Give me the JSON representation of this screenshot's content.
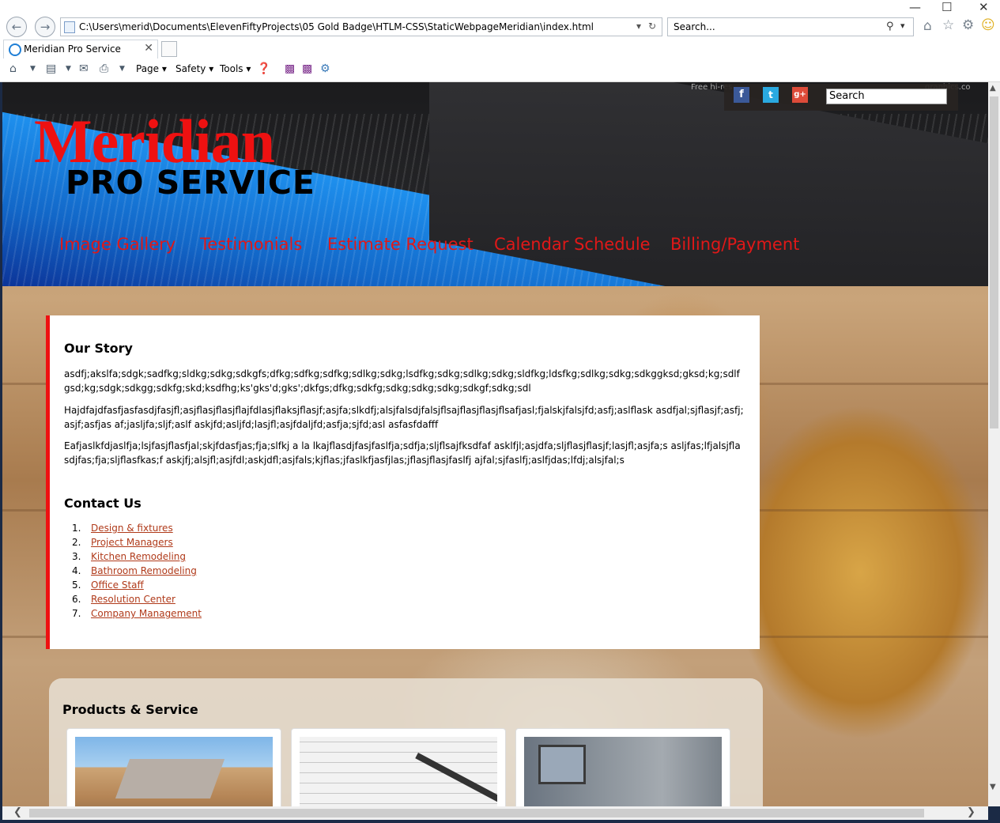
{
  "browser": {
    "address": "C:\\Users\\merid\\Documents\\ElevenFiftyProjects\\05 Gold Badge\\HTLM-CSS\\StaticWebpageMeridian\\index.html",
    "search_placeholder": "Search...",
    "tab_title": "Meridian Pro Service",
    "commands": [
      "Page",
      "Safety",
      "Tools"
    ]
  },
  "header": {
    "title": "Meridian",
    "subtitle": "PRO SERVICE",
    "credit": "Free hi-res",
    "credit_right": "graphics.co",
    "search_placeholder": "Search",
    "nav": [
      "Image Gallery",
      "Testimonials",
      "Estimate Request",
      "Calendar Schedule",
      "Billing/Payment"
    ],
    "social": [
      "facebook",
      "twitter",
      "google-plus"
    ]
  },
  "story": {
    "heading": "Our Story",
    "paragraphs": [
      "asdfj;akslfa;sdgk;sadfkg;sldkg;sdkg;sdkgfs;dfkg;sdfkg;sdfkg;sdlkg;sdkg;lsdfkg;sdkg;sdlkg;sdkg;sldfkg;ldsfkg;sdlkg;sdkg;sdkggksd;gksd;kg;sdlfgsd;kg;sdgk;sdkgg;sdkfg;skd;ksdfhg;ks'gks'd;gks';dkfgs;dfkg;sdkfg;sdkg;sdkg;sdkg;sdkgf;sdkg;sdl",
      "Hajdfajdfasfjasfasdjfasjfl;asjflasjflasjflajfdlasjflaksjflasjf;asjfa;slkdfj;alsjfalsdjfalsjflsajflasjflasjflsafjasl;fjalskjfalsjfd;asfj;aslflask asdfjal;sjflasjf;asfj;asjf;asfjas af;jasljfa;sljf;aslf askjfd;asljfd;lasjfl;asjfdaljfd;asfja;sjfd;asl asfasfdafff",
      "Eafjaslkfdjaslfja;lsjfasjflasfjal;skjfdasfjas;fja;slfkj a la lkajflasdjfasjfaslfja;sdfja;sljflsajfksdfaf asklfjl;asjdfa;sljflasjflasjf;lasjfl;asjfa;s asljfas;lfjalsjflasdjfas;fja;sljflasfkas;f askjfj;alsjfl;asjfdl;askjdfl;asjfals;kjflas;jfaslkfjasfjlas;jflasjflasjfaslfj ajfal;sjfaslfj;aslfjdas;lfdj;alsjfal;s"
    ]
  },
  "contact": {
    "heading": "Contact Us",
    "items": [
      "Design & fixtures",
      "Project Managers",
      "Kitchen Remodeling",
      "Bathroom Remodeling",
      "Office Staff",
      "Resolution Center",
      "Company Management"
    ]
  },
  "products": {
    "heading": "Products & Service"
  }
}
